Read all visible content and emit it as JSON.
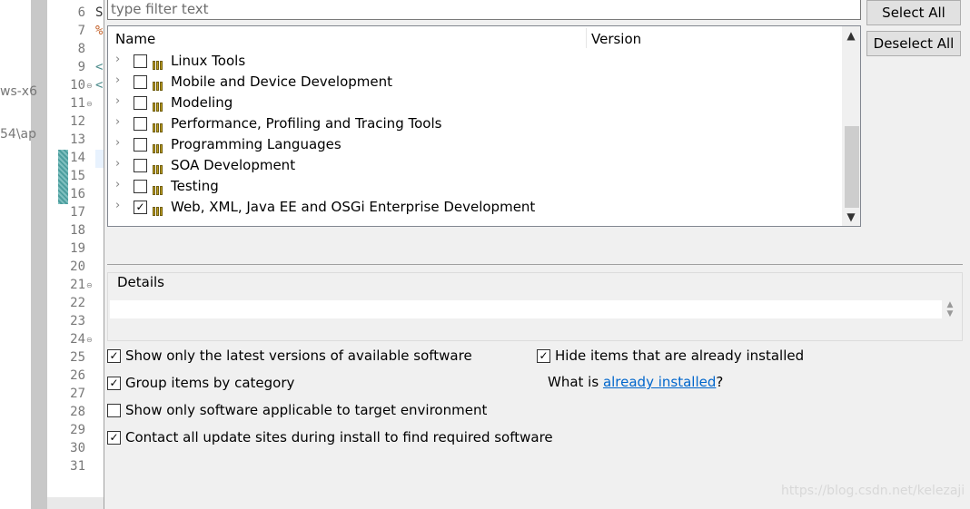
{
  "background": {
    "left_fragments": [
      "ws-x6",
      "54\\ap"
    ],
    "line_numbers": [
      "6",
      "7",
      "8",
      "9",
      "10",
      "11",
      "12",
      "13",
      "14",
      "15",
      "16",
      "17",
      "18",
      "19",
      "20",
      "21",
      "22",
      "23",
      "24",
      "25",
      "26",
      "27",
      "28",
      "29",
      "30",
      "31"
    ],
    "code_fragments": [
      "S",
      "%",
      "<",
      "<"
    ]
  },
  "filter": {
    "placeholder": "type filter text"
  },
  "buttons": {
    "select_all": "Select All",
    "deselect_all": "Deselect All"
  },
  "tree": {
    "columns": {
      "name": "Name",
      "version": "Version"
    },
    "items": [
      {
        "label": "Linux Tools",
        "checked": false
      },
      {
        "label": "Mobile and Device Development",
        "checked": false
      },
      {
        "label": "Modeling",
        "checked": false
      },
      {
        "label": "Performance, Profiling and Tracing Tools",
        "checked": false
      },
      {
        "label": "Programming Languages",
        "checked": false
      },
      {
        "label": "SOA Development",
        "checked": false
      },
      {
        "label": "Testing",
        "checked": false
      },
      {
        "label": "Web, XML, Java EE and OSGi Enterprise Development",
        "checked": true
      }
    ]
  },
  "details": {
    "label": "Details"
  },
  "options": {
    "latest_versions": {
      "label": "Show only the latest versions of available software",
      "checked": true
    },
    "group_by_category": {
      "label": "Group items by category",
      "checked": true
    },
    "target_env": {
      "label": "Show only software applicable to target environment",
      "checked": false
    },
    "contact_sites": {
      "label": "Contact all update sites during install to find required software",
      "checked": true
    },
    "hide_installed": {
      "label": "Hide items that are already installed",
      "checked": true
    }
  },
  "already_installed": {
    "prefix": "What is ",
    "link": "already installed",
    "suffix": "?"
  },
  "watermark": "https://blog.csdn.net/kelezaji",
  "colors": {
    "link": "#0066cc",
    "package_icon": "#c0a020"
  }
}
